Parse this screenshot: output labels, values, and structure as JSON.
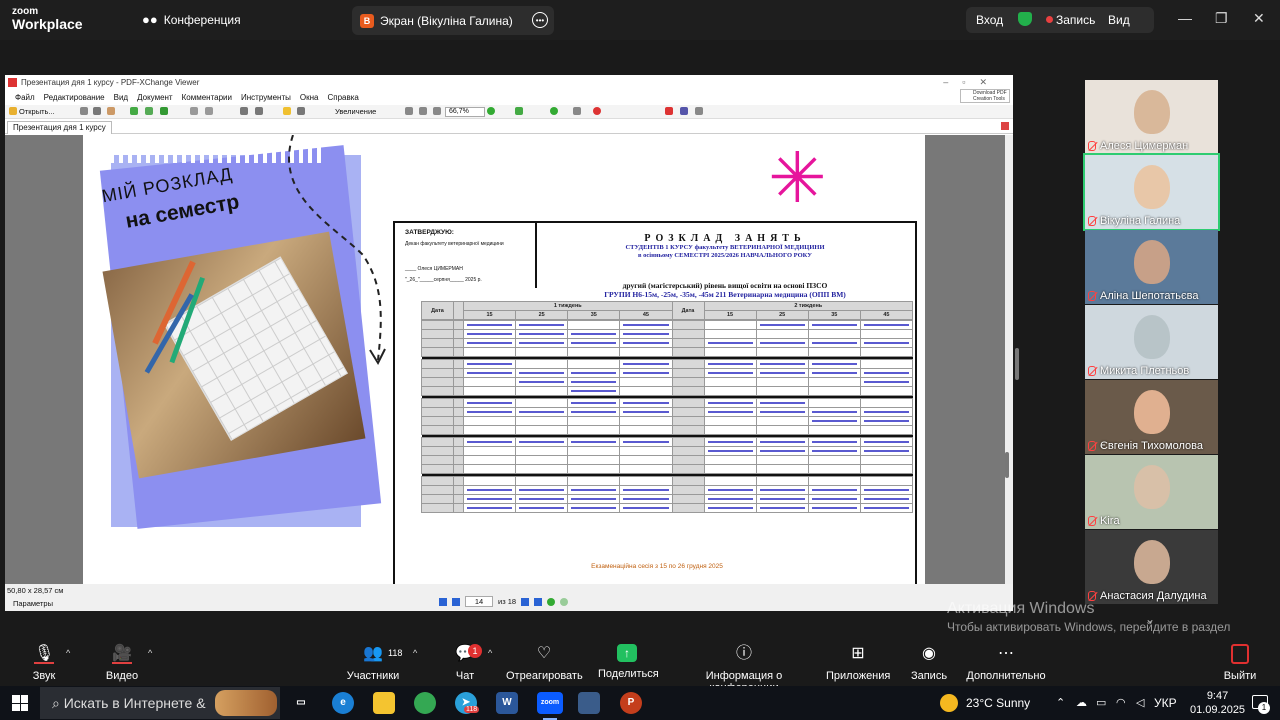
{
  "zoom": {
    "brand_top": "zoom",
    "brand_bottom": "Workplace",
    "conference_tab": "Конференция",
    "share_badge": "В",
    "share_title": "Экран (Вікуліна Галина)",
    "login": "Вход",
    "record": "Запись",
    "view": "Вид",
    "minimize": "—",
    "maximize": "❐",
    "close": "✕"
  },
  "pdf": {
    "window_title": "Презентация дяя 1 курсу - PDF-XChange Viewer",
    "menu": [
      "Файл",
      "Редактирование",
      "Вид",
      "Документ",
      "Комментарии",
      "Инструменты",
      "Окна",
      "Справка"
    ],
    "toolbar_open": "Открыть...",
    "toolbar_zoom_label": "Увеличение",
    "zoom_value": "66,7%",
    "download_logo": "Download PDF Creation Tools",
    "doc_tab": "Презентация дяя 1 курсу",
    "page_size": "50,80 x 28,57 см",
    "params": "Параметры",
    "page_current": "14",
    "page_total_label": "из 18"
  },
  "slide": {
    "my_schedule": "МІЙ РОЗКЛАД",
    "per_semester": "на семестр",
    "approve_label": "ЗАТВЕРДЖУЮ:",
    "approve_line1": "Декан факультету ветеринарної медицини",
    "approve_line2": "____ Олеся ЦИМЕРМАН",
    "approve_line3": "\"_26_\"_____серпня_____ 2025 р.",
    "title": "РОЗКЛАД ЗАНЯТЬ",
    "title_line2": "СТУДЕНТІВ 1 КУРСУ факультету ВЕТЕРИНАРНОЇ МЕДИЦИНИ",
    "title_line3": "в осінньому СЕМЕСТРІ 2025/2026 НАВЧАЛЬНОГО РОКУ",
    "sub_line1": "другий (магістерський) рівень вищої освіти на основі ПЗСО",
    "sub_line2": "ГРУПИ Н6-15м, -25м, -35м, -45м 211 Ветеринарна медицина (ОПП ВМ)",
    "week1": "1 тиждень",
    "week2": "2 тиждень",
    "date_col": "Дата",
    "groups": [
      "15",
      "25",
      "35",
      "45"
    ],
    "exam_note": "Екзаменаційна сесія з 15 по 26 грудня 2025"
  },
  "participants": [
    {
      "name": "Алеся Цимерман",
      "active": false
    },
    {
      "name": "Вікуліна Галина",
      "active": true
    },
    {
      "name": "Аліна Шепотатьєва",
      "active": false
    },
    {
      "name": "Микита Плетньов",
      "active": false
    },
    {
      "name": "Євгенія Тихомолова",
      "active": false
    },
    {
      "name": "Kira",
      "active": false
    },
    {
      "name": "Анастасия Далудина",
      "active": false
    }
  ],
  "activate": {
    "line1": "Активация Windows",
    "line2": "Чтобы активировать Windows, перейдите в раздел \"Параметры\"."
  },
  "toolbar": {
    "audio": "Звук",
    "video": "Видео",
    "participants": "Участники",
    "participants_count": "118",
    "chat": "Чат",
    "chat_badge": "1",
    "react": "Отреагировать",
    "share": "Поделиться",
    "info": "Информация о конференции",
    "apps": "Приложения",
    "record": "Запись",
    "more": "Дополнительно",
    "leave": "Выйти"
  },
  "taskbar": {
    "search_placeholder": "Искать в Интернете &",
    "telegram_badge": "118",
    "weather": "23°C Sunny",
    "language": "УКР",
    "time": "9:47",
    "date": "01.09.2025",
    "notif_count": "1"
  },
  "colors": {
    "accent_green": "#22c060",
    "record_red": "#e84040",
    "lavender": "#8c8ff0",
    "schedule_blue": "#2323a0"
  }
}
